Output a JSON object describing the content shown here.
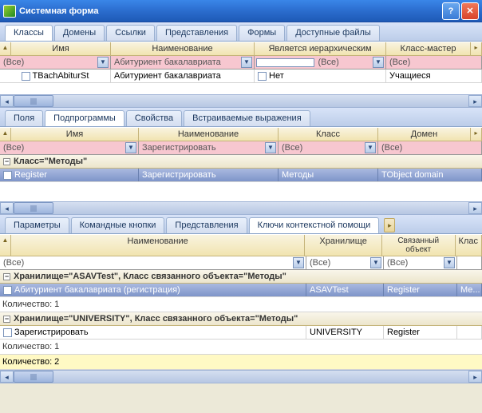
{
  "window": {
    "title": "Системная форма"
  },
  "strip1": {
    "tabs": [
      "Классы",
      "Домены",
      "Ссылки",
      "Представления",
      "Формы",
      "Доступные файлы"
    ],
    "active": 0
  },
  "grid1": {
    "headers": [
      "Имя",
      "Наименование",
      "Является иерархическим",
      "Класс-мастер"
    ],
    "filters": {
      "c0": "(Все)",
      "c1": "Абитуриент бакалавриата",
      "c2": "(Все)",
      "c3": "(Все)"
    },
    "row": {
      "c0": "TBachAbiturSt",
      "c1": "Абитуриент бакалавриата",
      "c2": "Нет",
      "c3": "Учащиеся"
    }
  },
  "strip2": {
    "tabs": [
      "Поля",
      "Подпрограммы",
      "Свойства",
      "Встраиваемые выражения"
    ],
    "active": 1
  },
  "grid2": {
    "headers": [
      "Имя",
      "Наименование",
      "Класс",
      "Домен"
    ],
    "filters": {
      "c0": "(Все)",
      "c1": "Зарегистрировать",
      "c2": "(Все)",
      "c3": "(Все)"
    },
    "group": "Класс=\"Методы\"",
    "row": {
      "c0": "Register",
      "c1": "Зарегистрировать",
      "c2": "Методы",
      "c3": "TObject domain"
    }
  },
  "strip3": {
    "tabs": [
      "Параметры",
      "Командные кнопки",
      "Представления",
      "Ключи контекстной помощи"
    ],
    "active": 3
  },
  "grid3": {
    "headers": [
      "Наименование",
      "Хранилище",
      "Связанный объект",
      "Клас"
    ],
    "filters": {
      "c0": "(Все)",
      "c1": "(Все)",
      "c2": "(Все)",
      "c3": ""
    },
    "group1": "Хранилище=\"ASAVTest\", Класс связанного объекта=\"Методы\"",
    "row1": {
      "c0": "Абитуриент бакалавриата (регистрация)",
      "c1": "ASAVTest",
      "c2": "Register",
      "c3": "Ме..."
    },
    "count1": "Количество: 1",
    "group2": "Хранилище=\"UNIVERSITY\", Класс связанного объекта=\"Методы\"",
    "row2": {
      "c0": "Зарегистрировать",
      "c1": "UNIVERSITY",
      "c2": "Register",
      "c3": ""
    },
    "count2": "Количество: 1",
    "total": "Количество: 2"
  }
}
